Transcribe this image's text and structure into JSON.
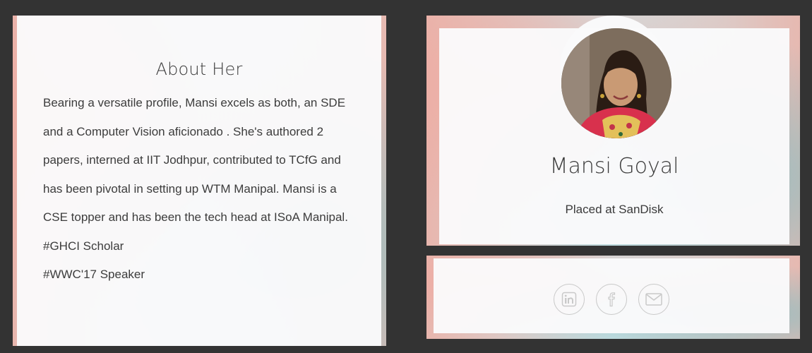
{
  "about": {
    "title": "About Her",
    "paragraph": "Bearing a versatile profile, Mansi excels as both, an SDE and a Computer Vision aficionado . She's authored 2 papers, interned at IIT Jodhpur, contributed to TCfG and has been pivotal in setting up WTM Manipal. Mansi is a CSE topper and has been the tech head at ISoA Manipal.",
    "tags": [
      "#GHCI Scholar",
      "#WWC'17 Speaker"
    ]
  },
  "profile": {
    "name": "Mansi Goyal",
    "subtitle": "Placed at SanDisk",
    "avatar_icon": "person-photo-icon"
  },
  "social": {
    "links": [
      {
        "icon": "linkedin-icon",
        "label": "in"
      },
      {
        "icon": "facebook-icon",
        "label": "f"
      },
      {
        "icon": "mail-icon",
        "label": ""
      }
    ],
    "icon_color": "#c9c9c9"
  },
  "colors": {
    "page_background": "#333333",
    "card_background": "#fafafb",
    "text": "#3a3a3a",
    "border_pink": "#e8b6ae",
    "border_teal": "#82bec3"
  }
}
